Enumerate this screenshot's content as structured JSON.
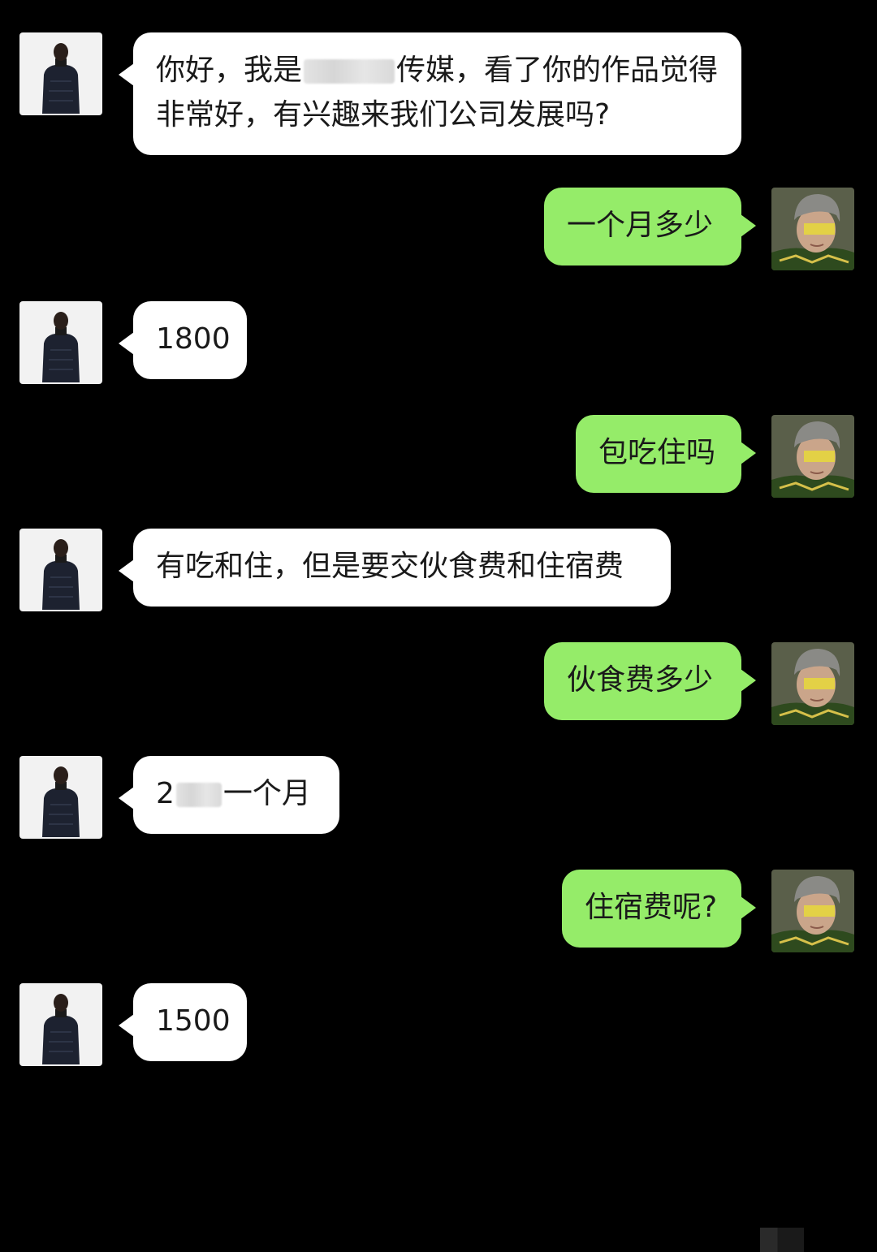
{
  "chat": {
    "messages": [
      {
        "side": "left",
        "text_before": "你好，我是",
        "redacted": true,
        "text_after": "传媒，看了你的作品觉得非常好，有兴趣来我们公司发展吗?"
      },
      {
        "side": "right",
        "text": "一个月多少"
      },
      {
        "side": "left",
        "text": "1800"
      },
      {
        "side": "right",
        "text": "包吃住吗"
      },
      {
        "side": "left",
        "text": "有吃和住，但是要交伙食费和住宿费"
      },
      {
        "side": "right",
        "text": "伙食费多少"
      },
      {
        "side": "left",
        "text_before": "2",
        "redacted": true,
        "text_after": "一个月"
      },
      {
        "side": "right",
        "text": "住宿费呢?"
      },
      {
        "side": "left",
        "text": "1500"
      }
    ]
  },
  "colors": {
    "background": "#000000",
    "incoming_bubble": "#ffffff",
    "outgoing_bubble": "#95ec69",
    "text": "#1a1a1a"
  },
  "icons": {
    "incoming_avatar": "person-in-black-puffer-jacket-avatar",
    "outgoing_avatar": "person-in-grey-beanie-avatar"
  }
}
